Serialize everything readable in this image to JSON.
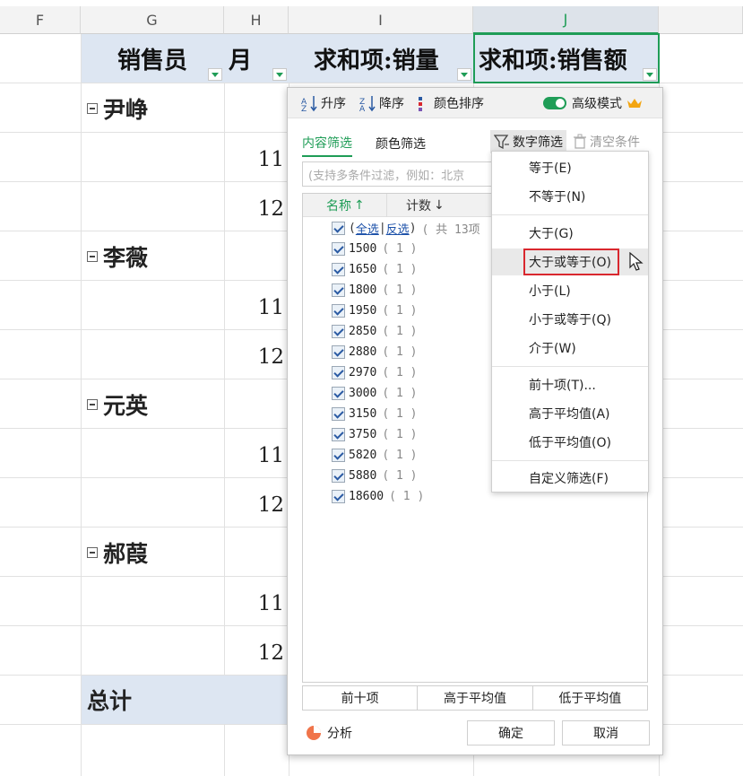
{
  "columns": [
    "F",
    "G",
    "H",
    "I",
    "J"
  ],
  "pivot_headers": [
    "销售员",
    "月",
    "求和项:销量",
    "求和项:销售额"
  ],
  "groups": [
    {
      "name": "尹峥",
      "months": [
        "11",
        "12"
      ]
    },
    {
      "name": "李薇",
      "months": [
        "11",
        "12"
      ]
    },
    {
      "name": "元英",
      "months": [
        "11",
        "12"
      ]
    },
    {
      "name": "郝葭",
      "months": [
        "11",
        "12"
      ]
    }
  ],
  "total_label": "总计",
  "toolbar": {
    "sort_asc": "升序",
    "sort_desc": "降序",
    "color_sort": "颜色排序",
    "advanced_mode": "高级模式"
  },
  "tabs": {
    "content": "内容筛选",
    "color": "颜色筛选"
  },
  "number_filter": "数字筛选",
  "clear_conditions": "清空条件",
  "search_placeholder": "(支持多条件过滤，例如：北京",
  "list_header": {
    "name": "名称",
    "count": "计数"
  },
  "select_all": {
    "all": "全选",
    "invert": "反选",
    "total": "( 共 13项"
  },
  "items": [
    {
      "value": "1500",
      "count": "( 1 )"
    },
    {
      "value": "1650",
      "count": "( 1 )"
    },
    {
      "value": "1800",
      "count": "( 1 )"
    },
    {
      "value": "1950",
      "count": "( 1 )"
    },
    {
      "value": "2850",
      "count": "( 1 )"
    },
    {
      "value": "2880",
      "count": "( 1 )"
    },
    {
      "value": "2970",
      "count": "( 1 )"
    },
    {
      "value": "3000",
      "count": "( 1 )"
    },
    {
      "value": "3150",
      "count": "( 1 )"
    },
    {
      "value": "3750",
      "count": "( 1 )"
    },
    {
      "value": "5820",
      "count": "( 1 )"
    },
    {
      "value": "5880",
      "count": "( 1 )"
    },
    {
      "value": "18600",
      "count": "( 1 )"
    }
  ],
  "bottom_buttons": {
    "top10": "前十项",
    "above_avg": "高于平均值",
    "below_avg": "低于平均值"
  },
  "footer": {
    "analyze": "分析",
    "ok": "确定",
    "cancel": "取消"
  },
  "menu": {
    "eq": "等于(E)",
    "neq": "不等于(N)",
    "gt": "大于(G)",
    "gte": "大于或等于(O)",
    "lt": "小于(L)",
    "lte": "小于或等于(Q)",
    "between": "介于(W)",
    "top10": "前十项(T)...",
    "above_avg": "高于平均值(A)",
    "below_avg": "低于平均值(O)",
    "custom": "自定义筛选(F)"
  },
  "colors": {
    "accent": "#1f9d57",
    "highlight_border": "#d9272e",
    "pivot_header_bg": "#dde6f2"
  }
}
